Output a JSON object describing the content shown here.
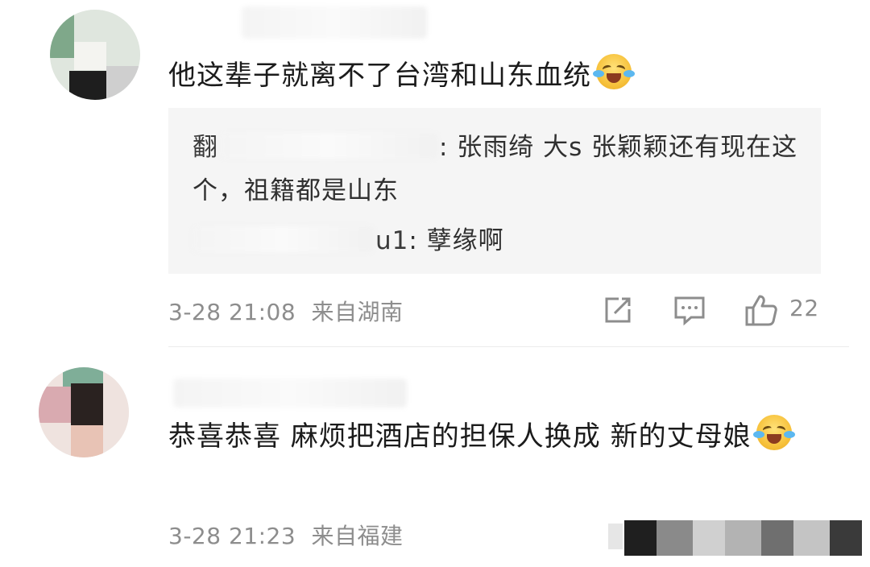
{
  "comments": [
    {
      "text": "他这辈子就离不了台湾和山东血统",
      "emoji": "laugh-cry-emoji",
      "replies": [
        {
          "user_visible": "翻",
          "user_suffix": ":",
          "text": " 张雨绮 大s 张颖颖还有现在这个，祖籍都是山东"
        },
        {
          "user_visible": "u1",
          "user_suffix": ":",
          "text": " 孽缘啊"
        }
      ],
      "time": "3-28 21:08",
      "location": "来自湖南",
      "like_count": "22"
    },
    {
      "text": "恭喜恭喜 麻烦把酒店的担保人换成 新的丈母娘",
      "emoji": "laugh-cry-emoji",
      "time": "3-28 21:23",
      "location": "来自福建"
    }
  ],
  "icons": {
    "share": "share-icon",
    "reply": "comment-icon",
    "like": "thumbs-up-icon"
  },
  "colors": {
    "meta_gray": "#8d8d8d",
    "reply_bg": "#f5f5f5"
  }
}
